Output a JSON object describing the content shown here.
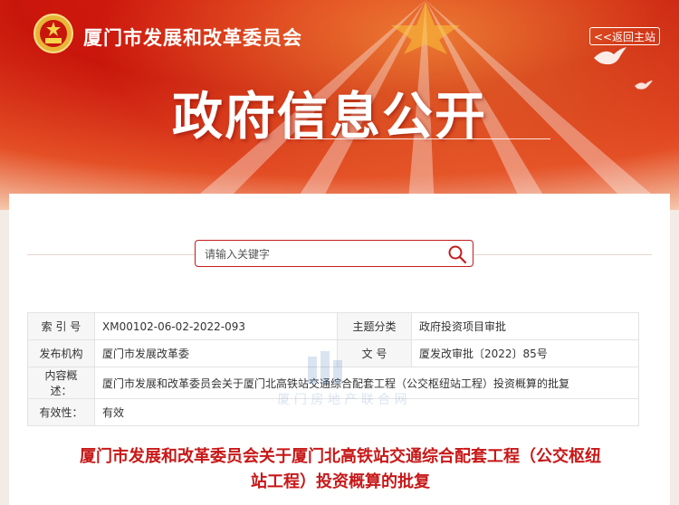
{
  "header": {
    "site_title": "厦门市发展和改革委员会",
    "back_home": "<<返回主站",
    "banner_title": "政府信息公开"
  },
  "search": {
    "placeholder": "请输入关键字"
  },
  "meta": {
    "index_label": "索 引 号",
    "index_value": "XM00102-06-02-2022-093",
    "category_label": "主题分类",
    "category_value": "政府投资项目审批",
    "publisher_label": "发布机构",
    "publisher_value": "厦门市发展改革委",
    "docno_label": "文 号",
    "docno_value": "厦发改审批〔2022〕85号",
    "summary_label": "内容概述：",
    "summary_value": "厦门市发展和改革委员会关于厦门北高铁站交通综合配套工程（公交枢纽站工程）投资概算的批复",
    "validity_label": "有效性：",
    "validity_value": "有效"
  },
  "watermark": {
    "text": "厦 门 房 地 产 联 合 网"
  },
  "document": {
    "title_line1": "厦门市发展和改革委员会关于厦门北高铁站交通综合配套工程（公交枢纽",
    "title_line2": "站工程）投资概算的批复"
  },
  "colors": {
    "brand_red": "#c81818",
    "banner_red": "#d81d10"
  }
}
